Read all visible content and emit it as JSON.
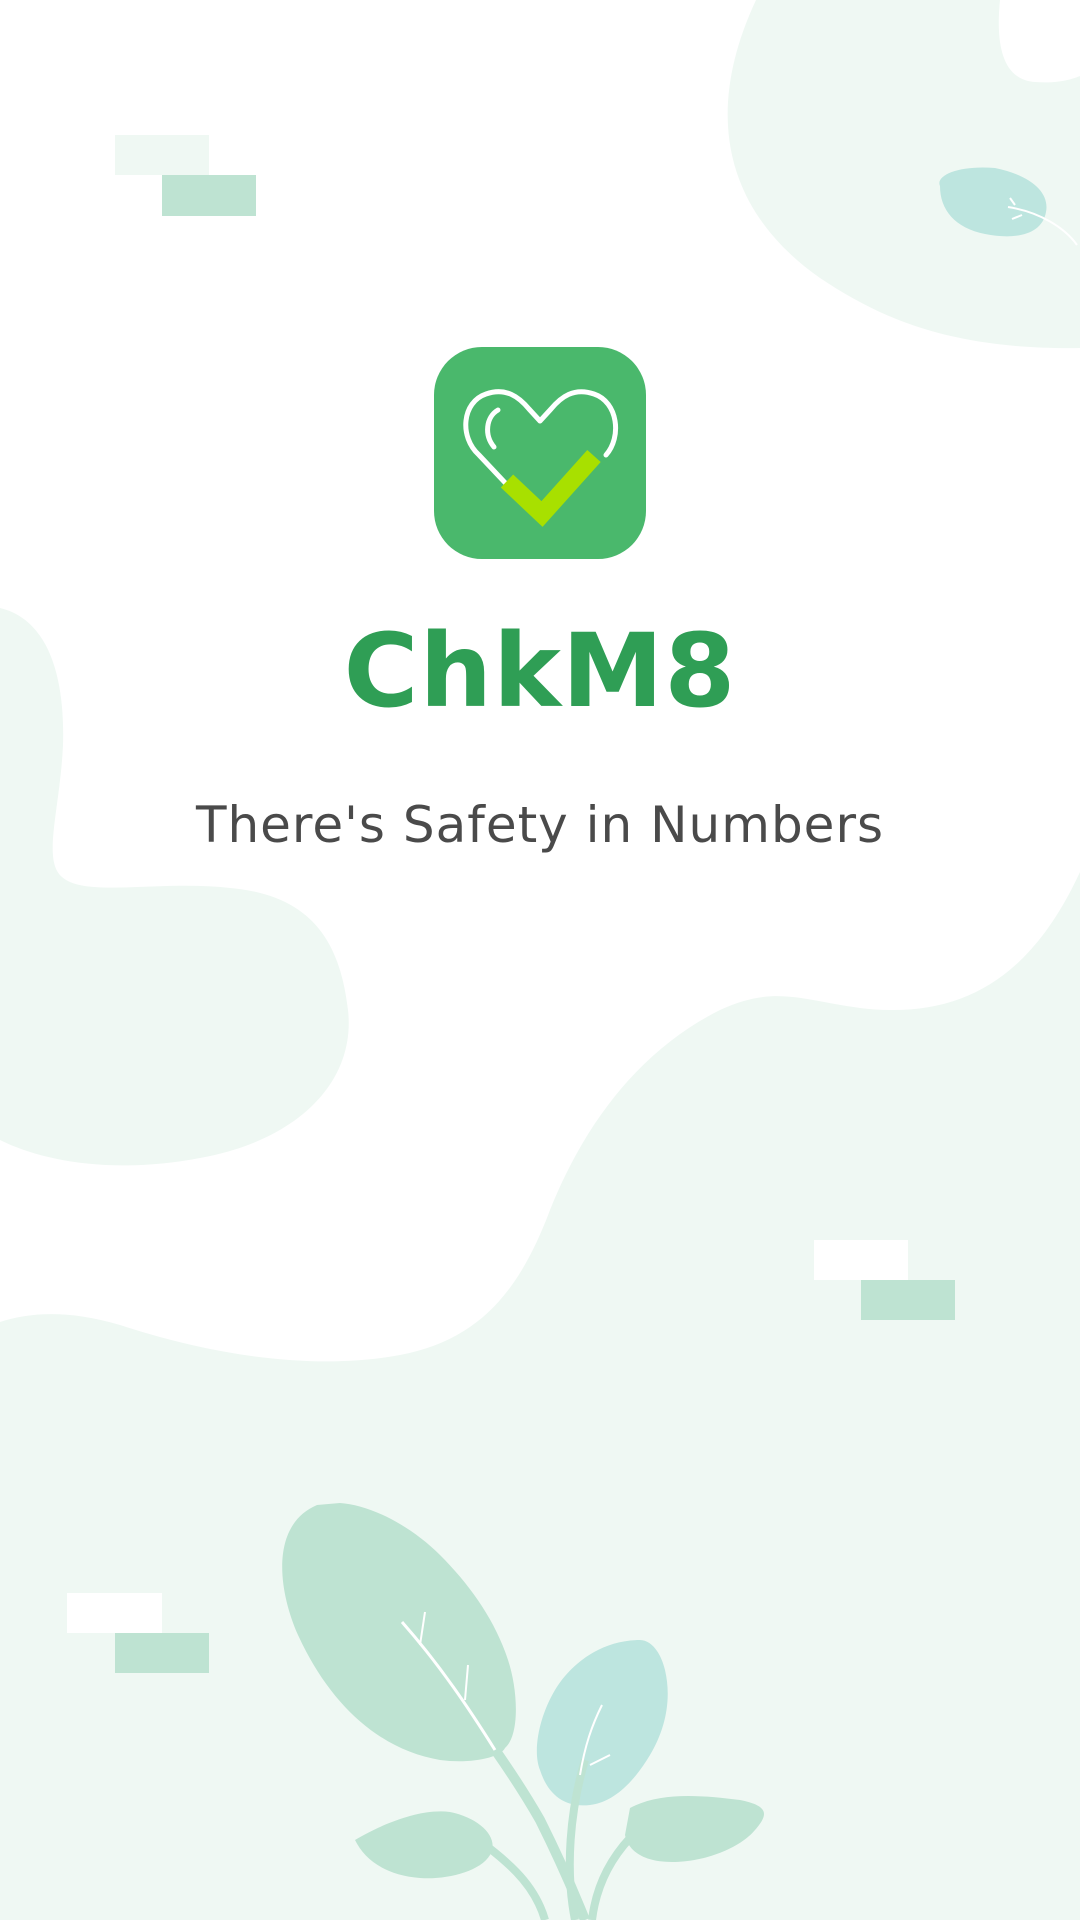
{
  "app": {
    "name": "ChkM8",
    "tagline": "There's Safety in Numbers"
  },
  "icons": {
    "app_icon": "heart-check-icon",
    "leaf": "leaf-icon",
    "plant": "plant-illustration"
  },
  "colors": {
    "brand_green": "#2f9e55",
    "icon_bg": "#4ab86c",
    "check_lime": "#a8e000",
    "blob_light": "#eff8f3",
    "leaf_mint": "#bee3d2",
    "leaf_teal": "#bde5df",
    "text_gray": "#4a4a4a"
  }
}
